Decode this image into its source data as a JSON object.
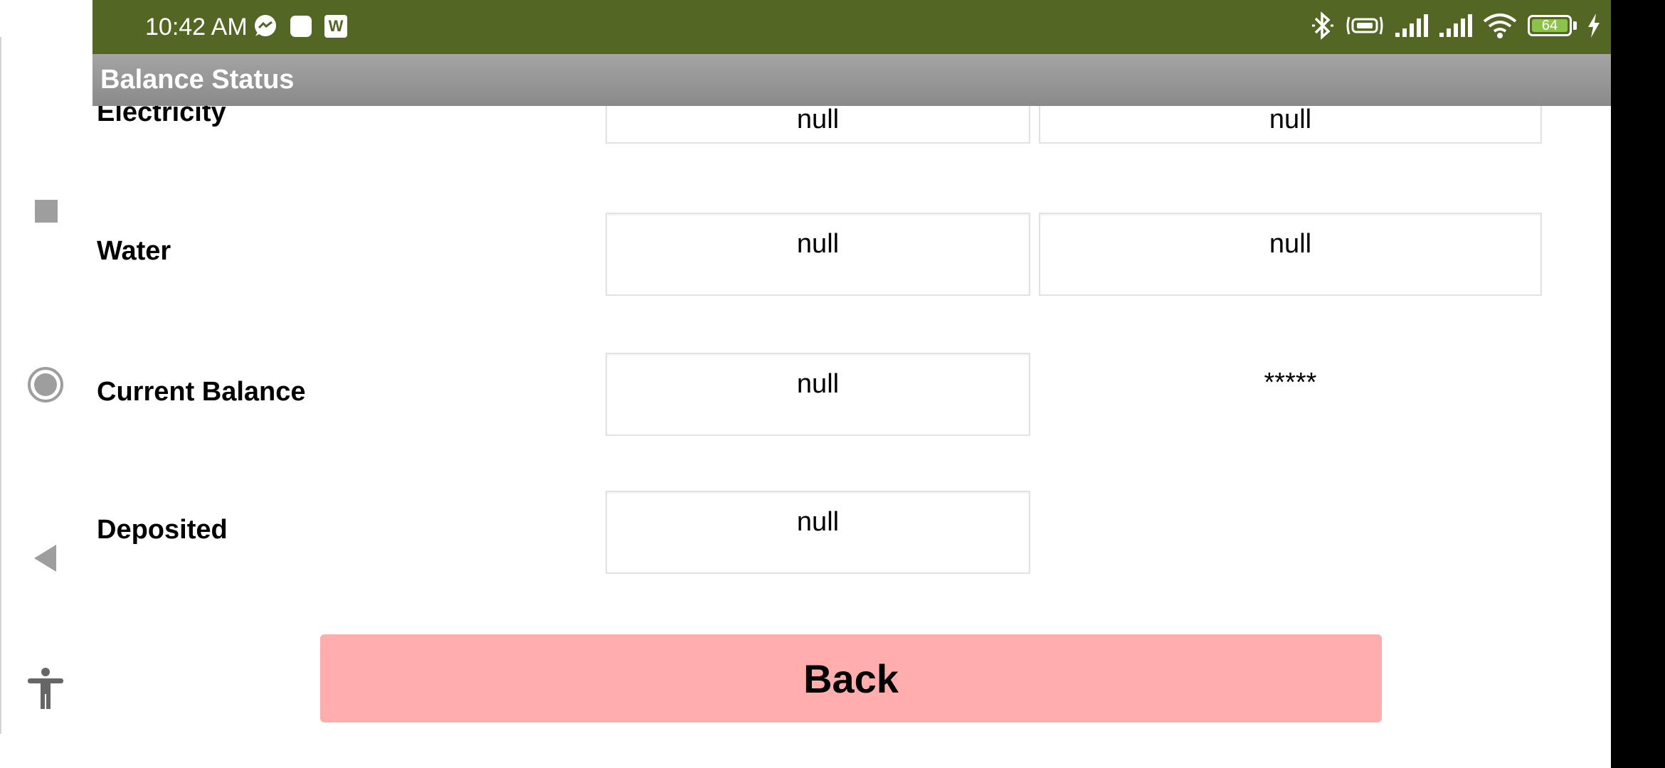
{
  "status_bar": {
    "time": "10:42 AM",
    "left_icons": [
      "messenger-icon",
      "notification-square-icon",
      "word-app-icon"
    ],
    "word_icon_letter": "W",
    "right_icons": [
      "bluetooth-icon",
      "vibrate-icon",
      "signal-1-icon",
      "signal-2-icon",
      "wifi-icon",
      "battery-icon",
      "charging-icon"
    ],
    "battery_level": "64",
    "background_color": "#536624"
  },
  "app_bar": {
    "title": "Balance Status"
  },
  "rows": [
    {
      "label": "Electricity",
      "value_1": "null",
      "value_2": "null"
    },
    {
      "label": "Water",
      "value_1": "null",
      "value_2": "null"
    },
    {
      "label": "Current Balance",
      "value_1": "null",
      "value_2": "*****"
    },
    {
      "label": "Deposited",
      "value_1": "null"
    }
  ],
  "back_button": {
    "label": "Back",
    "color": "#ffadad"
  },
  "nav_buttons": [
    "recents-square-icon",
    "home-circle-icon",
    "back-triangle-icon",
    "accessibility-icon"
  ]
}
